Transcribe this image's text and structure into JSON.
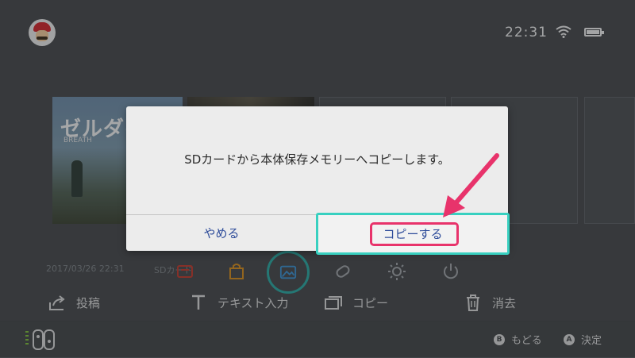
{
  "status": {
    "time": "22:31"
  },
  "capture": {
    "date": "2017/03/26 22:31",
    "source": "SDカード"
  },
  "thumbnails": {
    "game_title": "ゼルダの",
    "game_subtitle": "BREATH"
  },
  "actions": {
    "post": "投稿",
    "text_input": "テキスト入力",
    "copy": "コピー",
    "delete": "消去"
  },
  "hints": {
    "back_button": "B",
    "back_label": "もどる",
    "ok_button": "A",
    "ok_label": "決定"
  },
  "dialog": {
    "message": "SDカードから本体保存メモリーへコピーします。",
    "cancel": "やめる",
    "confirm": "コピーする"
  },
  "colors": {
    "focus": "#38d0c0",
    "annotation": "#e8336b",
    "button_text": "#2e4c9a"
  }
}
